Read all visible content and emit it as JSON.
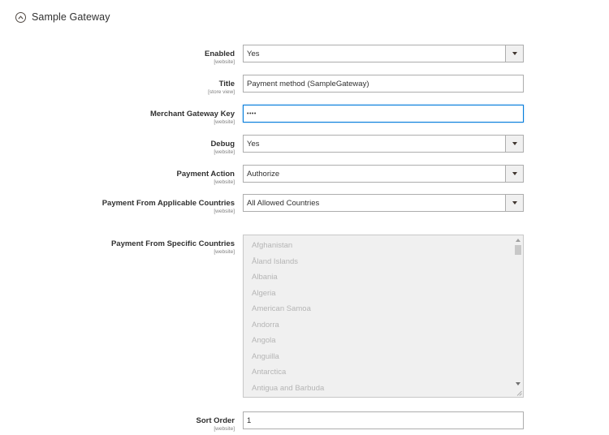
{
  "section": {
    "title": "Sample Gateway"
  },
  "fields": {
    "enabled": {
      "label": "Enabled",
      "scope": "[website]",
      "value": "Yes"
    },
    "title": {
      "label": "Title",
      "scope": "[store view]",
      "value": "Payment method (SampleGateway)"
    },
    "merchant_key": {
      "label": "Merchant Gateway Key",
      "scope": "[website]",
      "value": "••••"
    },
    "debug": {
      "label": "Debug",
      "scope": "[website]",
      "value": "Yes"
    },
    "payment_action": {
      "label": "Payment Action",
      "scope": "[website]",
      "value": "Authorize"
    },
    "applicable_countries": {
      "label": "Payment From Applicable Countries",
      "scope": "[website]",
      "value": "All Allowed Countries"
    },
    "specific_countries": {
      "label": "Payment From Specific Countries",
      "scope": "[website]",
      "options": [
        "Afghanistan",
        "Åland Islands",
        "Albania",
        "Algeria",
        "American Samoa",
        "Andorra",
        "Angola",
        "Anguilla",
        "Antarctica",
        "Antigua and Barbuda"
      ]
    },
    "sort_order": {
      "label": "Sort Order",
      "scope": "[website]",
      "value": "1"
    }
  },
  "colors": {
    "focus_border": "#007bdb",
    "input_border": "#adadad",
    "disabled_bg": "#f0f0f0"
  },
  "icons": {
    "section_toggle": "chevron-up-circle-icon",
    "select_arrow": "triangle-down-icon"
  }
}
